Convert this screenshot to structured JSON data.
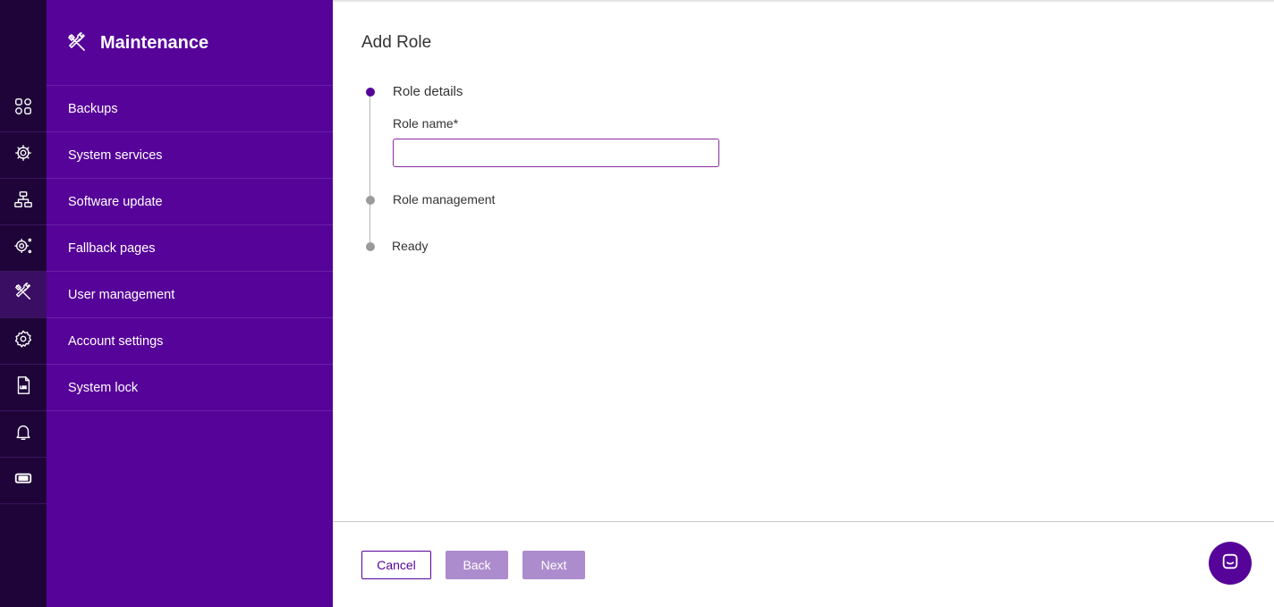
{
  "rail": {
    "items": [
      {
        "icon": "dashboard-grid-icon"
      },
      {
        "icon": "gear-network-icon"
      },
      {
        "icon": "network-topology-icon"
      },
      {
        "icon": "gear-dots-icon"
      },
      {
        "icon": "tools-icon",
        "active": true
      },
      {
        "icon": "gear-icon"
      },
      {
        "icon": "log-file-icon"
      },
      {
        "icon": "bell-icon"
      },
      {
        "icon": "ticket-icon"
      }
    ]
  },
  "nav": {
    "title": "Maintenance",
    "items": [
      {
        "label": "Backups"
      },
      {
        "label": "System services"
      },
      {
        "label": "Software update"
      },
      {
        "label": "Fallback pages"
      },
      {
        "label": "User management"
      },
      {
        "label": "Account settings"
      },
      {
        "label": "System lock"
      }
    ]
  },
  "main": {
    "title": "Add Role",
    "steps": [
      {
        "label": "Role details",
        "state": "active"
      },
      {
        "label": "Role management",
        "state": "pending"
      },
      {
        "label": "Ready",
        "state": "pending"
      }
    ],
    "form": {
      "role_name_label": "Role name*",
      "role_name_value": "",
      "role_name_placeholder": ""
    },
    "footer": {
      "cancel": "Cancel",
      "back": "Back",
      "next": "Next"
    }
  },
  "colors": {
    "rail_bg": "#1e0438",
    "nav_bg": "#560399",
    "accent": "#560399",
    "disabled_button": "#ad8ccd"
  }
}
